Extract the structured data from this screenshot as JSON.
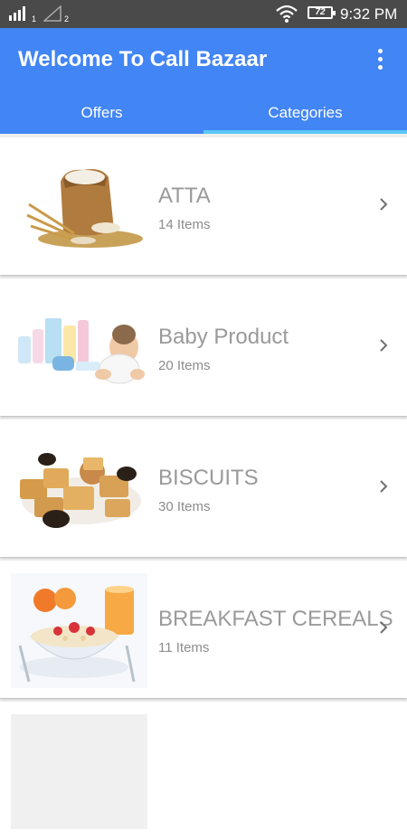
{
  "status_bar": {
    "sim1": "1",
    "sim2": "2",
    "battery": "72",
    "time": "9:32 PM"
  },
  "app_bar": {
    "title": "Welcome To Call Bazaar",
    "menu_icon": "more-vert-icon"
  },
  "tabs": [
    {
      "label": "Offers",
      "selected": false
    },
    {
      "label": "Categories",
      "selected": true
    }
  ],
  "colors": {
    "primary": "#4285f4",
    "tab_indicator": "#5bc8f5",
    "status_bar": "#4a4a4a"
  },
  "categories": [
    {
      "name": "ATTA",
      "count": "14 Items",
      "image": "flour-sack-image"
    },
    {
      "name": "Baby Product",
      "count": "20 Items",
      "image": "baby-products-image"
    },
    {
      "name": "BISCUITS",
      "count": "30 Items",
      "image": "biscuits-image"
    },
    {
      "name": "BREAKFAST CEREALS",
      "count": "11 Items",
      "image": "cereal-bowl-image"
    }
  ]
}
